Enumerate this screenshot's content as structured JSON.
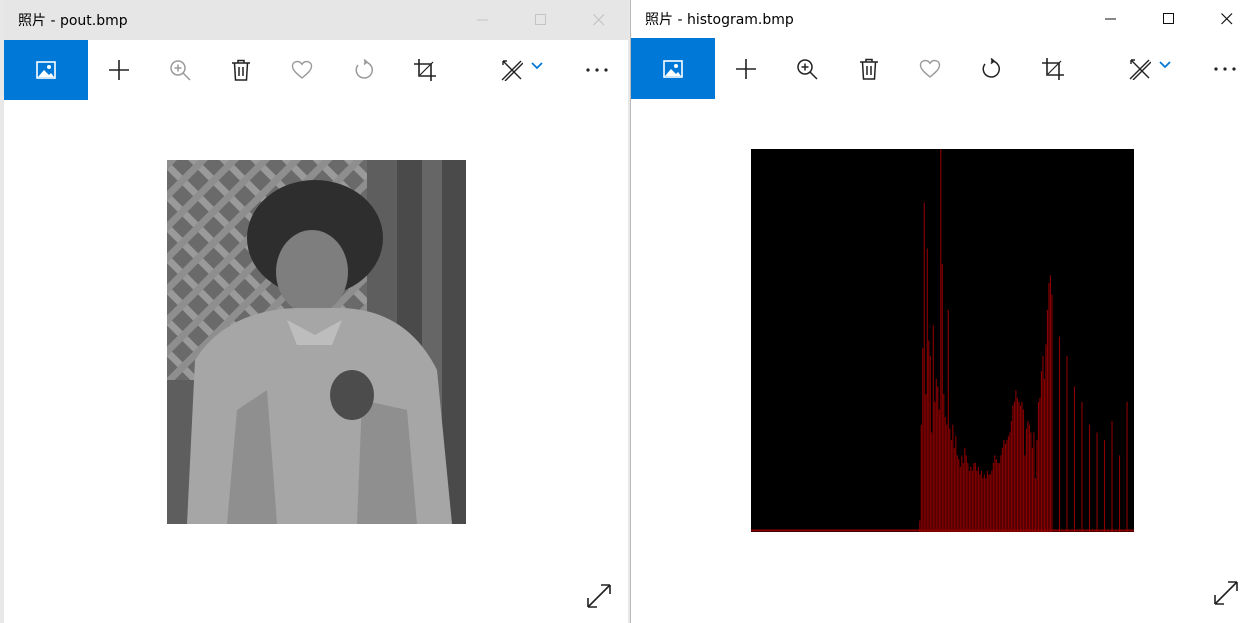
{
  "left_window": {
    "title": "照片 - pout.bmp",
    "active": false,
    "toolbar_icons": [
      "photo-icon",
      "add-icon",
      "zoom-in-icon",
      "delete-icon",
      "favorite-icon",
      "rotate-icon",
      "crop-icon",
      "edit-draw-icon",
      "chevron-down-icon",
      "more-icon"
    ],
    "image_description_icon": "grayscale-photo-child"
  },
  "right_window": {
    "title": "照片 - histogram.bmp",
    "active": true,
    "toolbar_icons": [
      "photo-icon",
      "add-icon",
      "zoom-in-icon",
      "delete-icon",
      "favorite-icon",
      "rotate-icon",
      "crop-icon",
      "edit-draw-icon",
      "chevron-down-icon",
      "more-icon"
    ]
  },
  "colors": {
    "accent": "#0078d7",
    "histogram_bar": "#8b0000",
    "histogram_bg": "#000000"
  },
  "chart_data": {
    "type": "bar",
    "title": "",
    "xlabel": "",
    "ylabel": "",
    "xlim": [
      0,
      255
    ],
    "ylim": [
      0,
      1
    ],
    "x": [
      112,
      113,
      114,
      115,
      116,
      117,
      118,
      119,
      120,
      121,
      122,
      123,
      124,
      125,
      126,
      127,
      128,
      129,
      130,
      131,
      132,
      133,
      134,
      135,
      136,
      137,
      138,
      139,
      140,
      141,
      142,
      143,
      144,
      145,
      146,
      147,
      148,
      149,
      150,
      151,
      152,
      153,
      154,
      155,
      156,
      157,
      158,
      159,
      160,
      161,
      162,
      163,
      164,
      165,
      166,
      167,
      168,
      169,
      170,
      171,
      172,
      173,
      174,
      175,
      176,
      177,
      178,
      179,
      180,
      181,
      182,
      183,
      184,
      185,
      186,
      187,
      188,
      189,
      190,
      191,
      192,
      193,
      194,
      195,
      196,
      197,
      198,
      199,
      200,
      205,
      210,
      215,
      220,
      225,
      230,
      235,
      240,
      245,
      250
    ],
    "values": [
      0.03,
      0.28,
      0.48,
      0.86,
      0.36,
      0.74,
      0.5,
      0.46,
      0.26,
      0.54,
      0.34,
      0.4,
      0.38,
      0.32,
      1.0,
      0.7,
      0.36,
      0.3,
      0.28,
      0.58,
      0.27,
      0.24,
      0.28,
      0.22,
      0.25,
      0.2,
      0.19,
      0.17,
      0.2,
      0.18,
      0.22,
      0.2,
      0.18,
      0.16,
      0.17,
      0.16,
      0.18,
      0.18,
      0.16,
      0.17,
      0.15,
      0.16,
      0.14,
      0.15,
      0.14,
      0.16,
      0.15,
      0.15,
      0.16,
      0.18,
      0.2,
      0.19,
      0.18,
      0.18,
      0.2,
      0.22,
      0.24,
      0.23,
      0.24,
      0.25,
      0.26,
      0.29,
      0.33,
      0.34,
      0.37,
      0.35,
      0.34,
      0.33,
      0.34,
      0.32,
      0.2,
      0.27,
      0.29,
      0.28,
      0.26,
      0.22,
      0.26,
      0.14,
      0.24,
      0.34,
      0.35,
      0.42,
      0.46,
      0.4,
      0.49,
      0.58,
      0.65,
      0.67,
      0.62,
      0.51,
      0.46,
      0.38,
      0.34,
      0.28,
      0.26,
      0.24,
      0.29,
      0.2,
      0.34
    ]
  }
}
